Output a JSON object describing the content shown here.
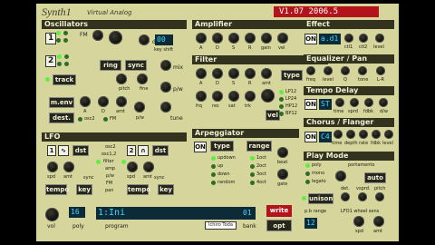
{
  "title": "Synth1",
  "subtitle": "Virtual Analog",
  "version": "V1.07 2006.5",
  "oscillators": {
    "header": "Oscillators",
    "osc1": "1",
    "osc2": "2",
    "det_label": "det.",
    "fm_label": "FM",
    "ring": "ring",
    "sync": "sync",
    "track": "track",
    "pitch": "pitch",
    "fine": "fine",
    "key_shift": "key shift",
    "key_shift_value": "00",
    "mix": "mix",
    "pw": "p/w",
    "tune": "tune",
    "menv": "m.env",
    "dest": "dest.",
    "a": "A",
    "d": "D",
    "amt": "amt",
    "osc2_label": "osc2",
    "fm2": "FM",
    "pw2": "p/w"
  },
  "amplifier": {
    "header": "Amplifier",
    "labels": [
      "A",
      "D",
      "S",
      "R",
      "gain",
      "vel"
    ]
  },
  "filter": {
    "header": "Filter",
    "labels_row1": [
      "A",
      "D",
      "S",
      "R",
      "amt"
    ],
    "labels_row2": [
      "frq",
      "res",
      "sat",
      "trk"
    ],
    "type": "type",
    "vel": "vel",
    "types": [
      "LP12",
      "LP24",
      "HP12",
      "BP12"
    ]
  },
  "effect": {
    "header": "Effect",
    "on": "ON",
    "value": "a.d1",
    "labels": [
      "ctl1",
      "ctl2",
      "level"
    ]
  },
  "eq": {
    "header": "Equalizer / Pan",
    "labels": [
      "freq",
      "level",
      "Q",
      "tone",
      "L-R"
    ]
  },
  "delay": {
    "header": "Tempo Delay",
    "on": "ON",
    "value": "ST",
    "labels": [
      "time",
      "sprd",
      "fdbk",
      "d/w"
    ]
  },
  "chorus": {
    "header": "Chorus / Flanger",
    "on": "ON",
    "value": "C4",
    "labels": [
      "time",
      "depth",
      "rate",
      "fdbk",
      "level"
    ]
  },
  "lfo": {
    "header": "LFO",
    "num1": "1",
    "num2": "2",
    "dst": "dst",
    "spd": "spd",
    "amt": "amt",
    "dst_options": [
      "osc2",
      "osc1,2",
      "filter",
      "amp",
      "p/w",
      "FM",
      "pan"
    ],
    "sync": "sync",
    "tempo": "tempo",
    "key": "key"
  },
  "arpeggiator": {
    "header": "Arpeggiator",
    "on": "ON",
    "type": "type",
    "range": "range",
    "types": [
      "updown",
      "up",
      "down",
      "random"
    ],
    "ranges": [
      "1oct",
      "2oct",
      "3oct",
      "4oct"
    ],
    "beat": "beat",
    "gate": "gate"
  },
  "playmode": {
    "header": "Play Mode",
    "modes": [
      "poly",
      "mono",
      "legato"
    ],
    "portamento": "portamento",
    "auto": "auto",
    "unison": "unison",
    "unison_labels": [
      "det.",
      "vsprd.",
      "pitch"
    ],
    "pb_range": "p.b range",
    "lfo1_wheel_sens": "LFO1 wheel sens",
    "pb_value": "12",
    "spd": "spd",
    "amt": "amt"
  },
  "bottom": {
    "vol": "vol",
    "voices": "16",
    "poly": "poly",
    "program": "program",
    "program_value": "1:Ini",
    "bank": "bank",
    "bank_value": "01",
    "write": "write",
    "opt": "opt",
    "logo": "Ichiro Toda"
  }
}
